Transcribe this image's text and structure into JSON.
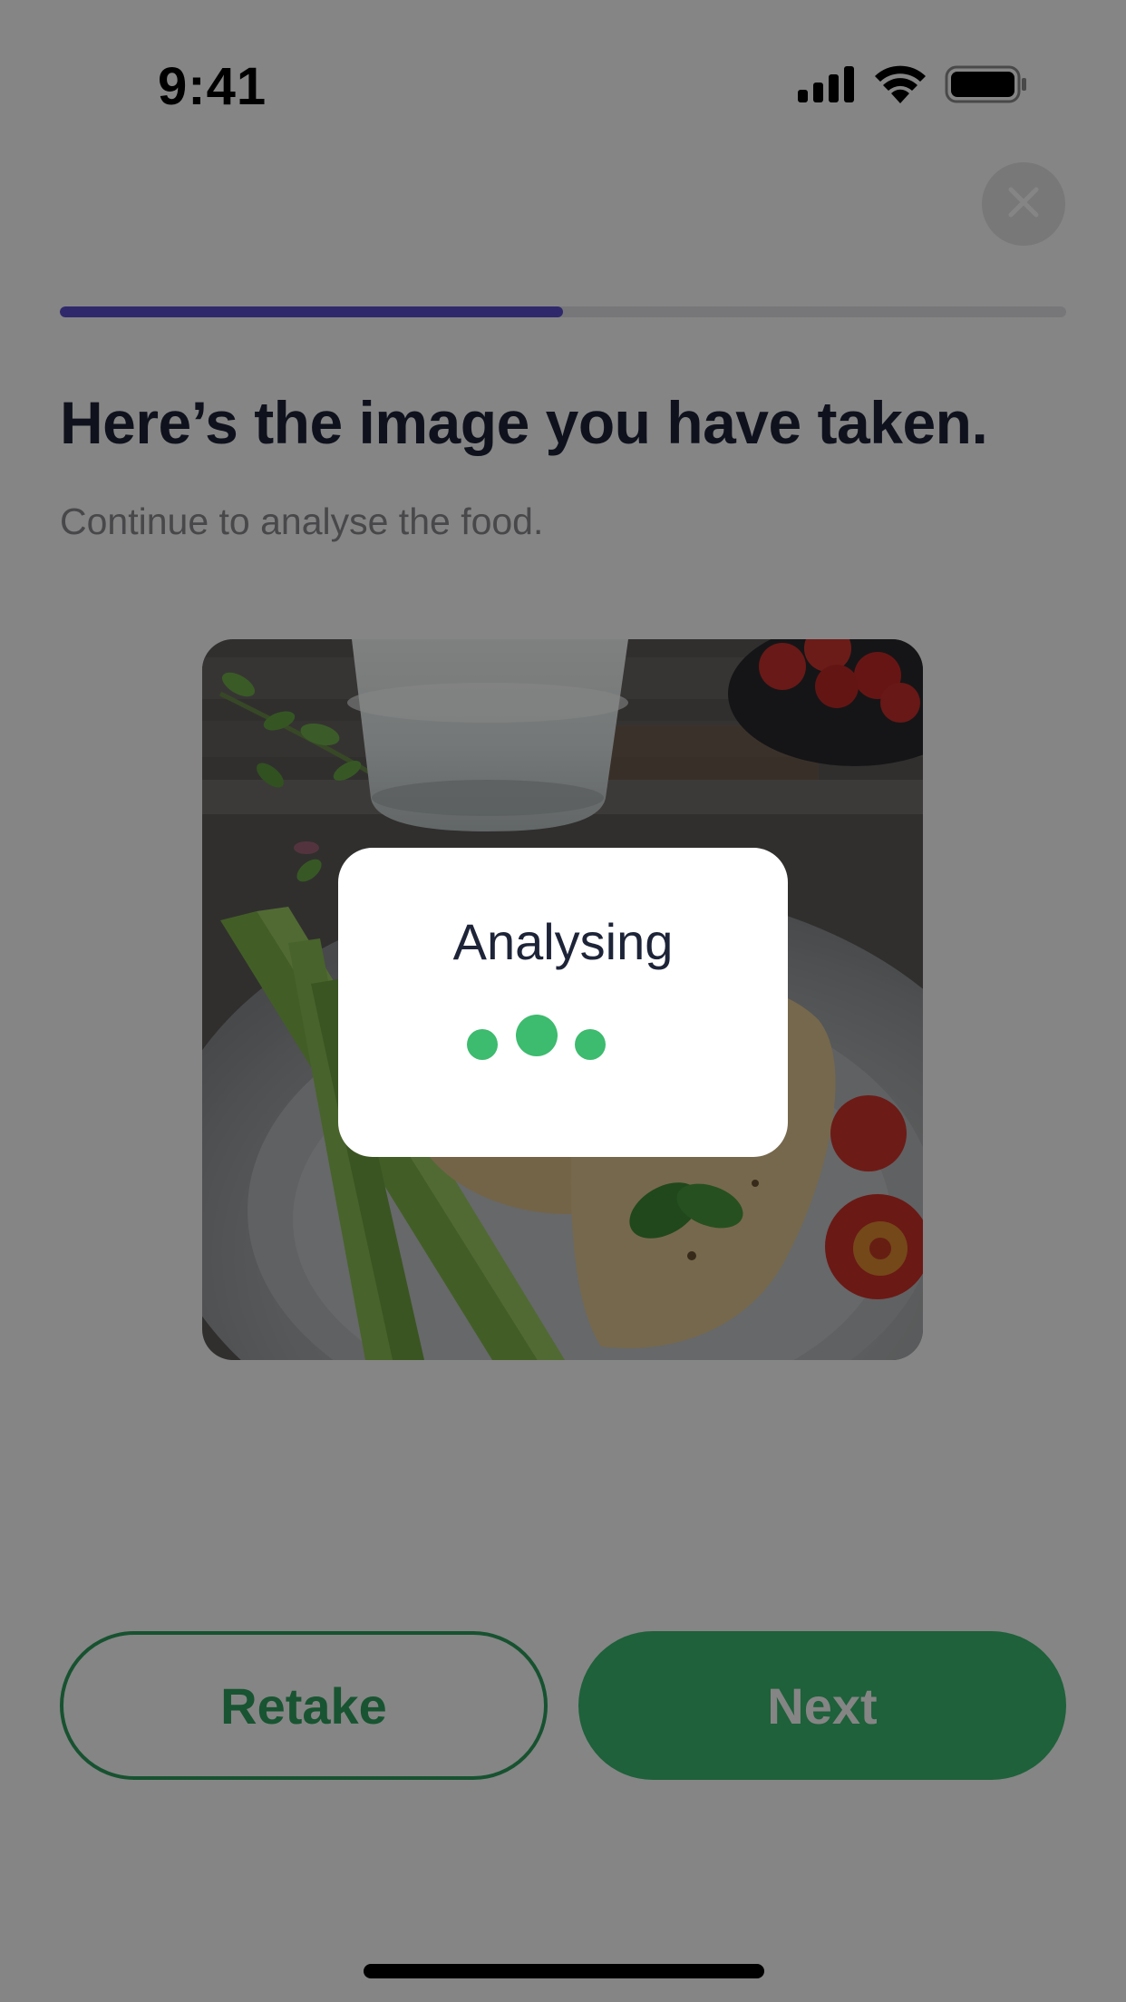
{
  "status_bar": {
    "time": "9:41",
    "icons": [
      "cellular-signal-icon",
      "wifi-icon",
      "battery-icon"
    ]
  },
  "header": {
    "close_icon": "close-icon",
    "progress_fraction": 0.5
  },
  "content": {
    "title": "Here’s the image you have taken.",
    "subtitle": "Continue to analyse the food.",
    "image_subject": "food-photo"
  },
  "overlay": {
    "label": "Analysing",
    "dots": 3
  },
  "actions": {
    "retake_label": "Retake",
    "next_label": "Next"
  },
  "colors": {
    "progress_fill": "#5a4fcf",
    "primary_green": "#3aba6f",
    "title_text": "#1e2438"
  }
}
